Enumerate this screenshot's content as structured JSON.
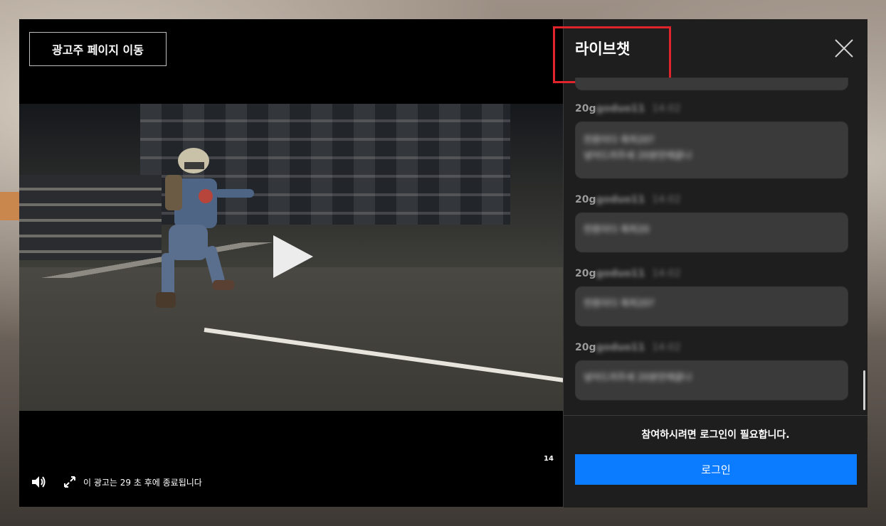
{
  "ad": {
    "advertiser_link_label": "광고주 페이지 이동",
    "age_rating": "14",
    "countdown_text": "이 광고는 29 초 후에 종료됩니다"
  },
  "chat": {
    "title": "라이브챗",
    "messages": [
      {
        "user_prefix": "20g",
        "user_rest": "goduo11",
        "time": "14:02",
        "lines": [
          "천원이다 축하20?",
          "넣어드려주세 20분만에끝나"
        ]
      },
      {
        "user_prefix": "20g",
        "user_rest": "goduo11",
        "time": "14:02",
        "lines": [
          "천원이다 축하20"
        ]
      },
      {
        "user_prefix": "20g",
        "user_rest": "goduo11",
        "time": "14:02",
        "lines": [
          "천원이다 축하20?"
        ]
      },
      {
        "user_prefix": "20g",
        "user_rest": "goduo11",
        "time": "14:02",
        "lines": [
          "넣어드려주세 20분만에끝나"
        ]
      }
    ],
    "login_notice": "참여하시려면 로그인이 필요합니다.",
    "login_button": "로그인"
  },
  "icons": {
    "play": "play-icon",
    "close": "close-icon",
    "volume": "volume-icon",
    "fullscreen": "fullscreen-icon"
  },
  "colors": {
    "login_button": "#0b7bff",
    "highlight_box": "#e1242b",
    "chat_background": "#1e1e1e",
    "bubble_background": "#3a3a3a"
  }
}
